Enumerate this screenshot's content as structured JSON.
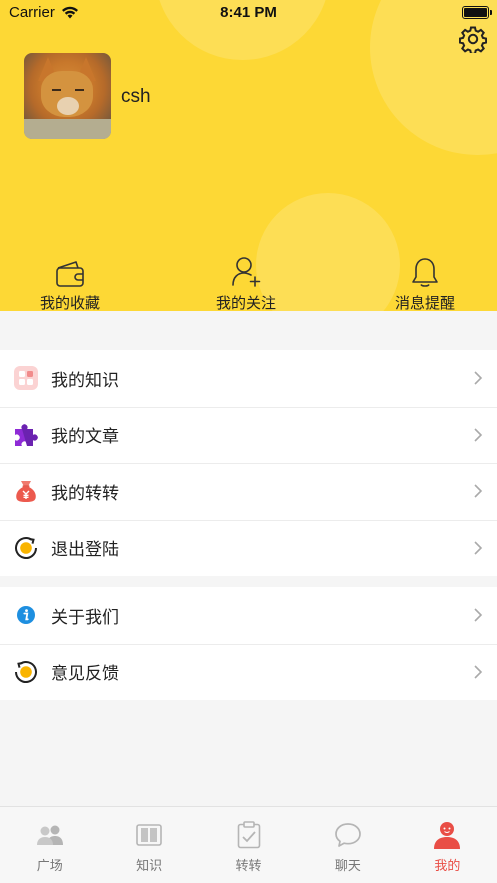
{
  "status_bar": {
    "carrier": "Carrier",
    "time": "8:41 PM"
  },
  "profile": {
    "username": "csh",
    "avatar_icon": "fox-avatar",
    "settings_icon": "gear-icon"
  },
  "quick_actions": [
    {
      "label": "我的收藏",
      "icon": "wallet-icon"
    },
    {
      "label": "我的关注",
      "icon": "user-add-icon"
    },
    {
      "label": "消息提醒",
      "icon": "bell-icon"
    }
  ],
  "menu_group_1": [
    {
      "label": "我的知识",
      "icon": "knowledge-icon"
    },
    {
      "label": "我的文章",
      "icon": "puzzle-icon"
    },
    {
      "label": "我的转转",
      "icon": "money-bag-icon"
    },
    {
      "label": "退出登陆",
      "icon": "logout-icon"
    }
  ],
  "menu_group_2": [
    {
      "label": "关于我们",
      "icon": "info-icon"
    },
    {
      "label": "意见反馈",
      "icon": "feedback-icon"
    }
  ],
  "tabs": [
    {
      "label": "广场",
      "icon": "people-icon",
      "active": false
    },
    {
      "label": "知识",
      "icon": "book-icon",
      "active": false
    },
    {
      "label": "转转",
      "icon": "clipboard-icon",
      "active": false
    },
    {
      "label": "聊天",
      "icon": "chat-icon",
      "active": false
    },
    {
      "label": "我的",
      "icon": "person-icon",
      "active": true
    }
  ],
  "colors": {
    "header_bg": "#fdd835",
    "active_tab": "#e94e46",
    "page_bg": "#f5f5f5"
  }
}
